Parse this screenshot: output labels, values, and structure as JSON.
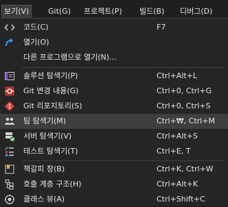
{
  "menubar": [
    {
      "label": "보기(V)",
      "active": true
    },
    {
      "label": "Git(G)"
    },
    {
      "label": "프로젝트(P)"
    },
    {
      "label": "빌드(B)"
    },
    {
      "label": "디버그(D)"
    }
  ],
  "menu": {
    "items": [
      {
        "label": "코드(C)",
        "shortcut": "F7",
        "icon": "code-icon"
      },
      {
        "label": "열기(O)",
        "shortcut": "",
        "icon": "open-arrow-icon"
      },
      {
        "label": "다른 프로그램으로 열기(N)...",
        "shortcut": "",
        "icon": ""
      },
      {
        "label": "솔루션 탐색기(P)",
        "shortcut": "Ctrl+Alt+L",
        "icon": "solution-explorer-icon"
      },
      {
        "label": "Git 변경 내용(G)",
        "shortcut": "Ctrl+0, Ctrl+G",
        "icon": "git-changes-icon"
      },
      {
        "label": "Git 리포지토리(S)",
        "shortcut": "Ctrl+0, Ctrl+S",
        "icon": "git-repository-icon"
      },
      {
        "label": "팀 탐색기(M)",
        "shortcut": "Ctrl+₩, Ctrl+M",
        "icon": "team-explorer-icon"
      },
      {
        "label": "서버 탐색기(V)",
        "shortcut": "Ctrl+Alt+S",
        "icon": "server-explorer-icon"
      },
      {
        "label": "테스트 탐색기(T)",
        "shortcut": "Ctrl+E, T",
        "icon": "test-explorer-icon"
      },
      {
        "label": "책갈피 창(B)",
        "shortcut": "Ctrl+K, Ctrl+W",
        "icon": "bookmark-window-icon"
      },
      {
        "label": "호출 계층 구조(H)",
        "shortcut": "Ctrl+Alt+K",
        "icon": "call-hierarchy-icon"
      },
      {
        "label": "클래스 뷰(A)",
        "shortcut": "Ctrl+Shift+C",
        "icon": "class-view-icon"
      }
    ]
  },
  "colors": {
    "accent_purple": "#b180d7",
    "git_red": "#e0473a",
    "highlight": "#3e3e40",
    "menu_bg": "#252526"
  }
}
